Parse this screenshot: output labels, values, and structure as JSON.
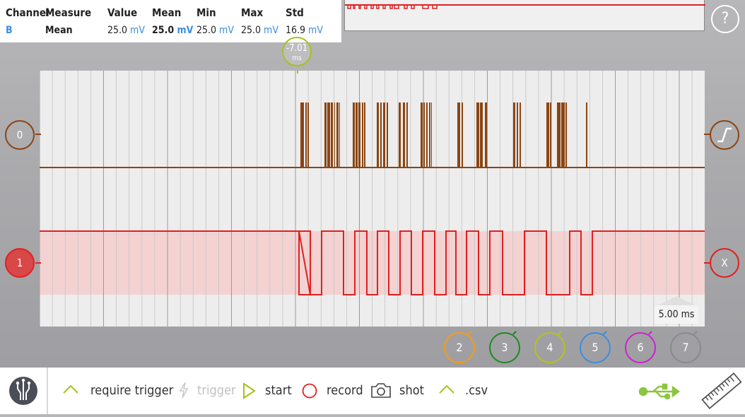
{
  "measurements": {
    "headers": [
      "Channel",
      "Measure",
      "Value",
      "Mean",
      "Min",
      "Max",
      "Std"
    ],
    "row": {
      "channel": "B",
      "measure": "Mean",
      "value": "25.0",
      "mean": "25.0",
      "min": "25.0",
      "max": "25.0",
      "std": "16.9",
      "unit": "mV"
    }
  },
  "help_label": "?",
  "cursor": {
    "value": "-7.01",
    "unit": "ms"
  },
  "channels": {
    "ch0_label": "0",
    "ch1_label": "1",
    "trigger_icon": "rising-edge-icon",
    "x_label": "X"
  },
  "timebase": "5.00 ms",
  "channel_buttons": [
    {
      "label": "2",
      "color": "#f39c12"
    },
    {
      "label": "3",
      "color": "#1e8a1e"
    },
    {
      "label": "4",
      "color": "#b8c21a"
    },
    {
      "label": "5",
      "color": "#3a8de0"
    },
    {
      "label": "6",
      "color": "#d01fd0"
    },
    {
      "label": "7",
      "color": "#8a8a8a"
    }
  ],
  "toolbar": {
    "require_trigger": "require trigger",
    "trigger": "trigger",
    "start": "start",
    "record": "record",
    "shot": "shot",
    "csv": ".csv"
  },
  "colors": {
    "digital": "#8b4513",
    "analog": "#e02020",
    "cursor": "#a6c21a",
    "accent": "#3a8de0",
    "band": "#f4d2d2"
  }
}
